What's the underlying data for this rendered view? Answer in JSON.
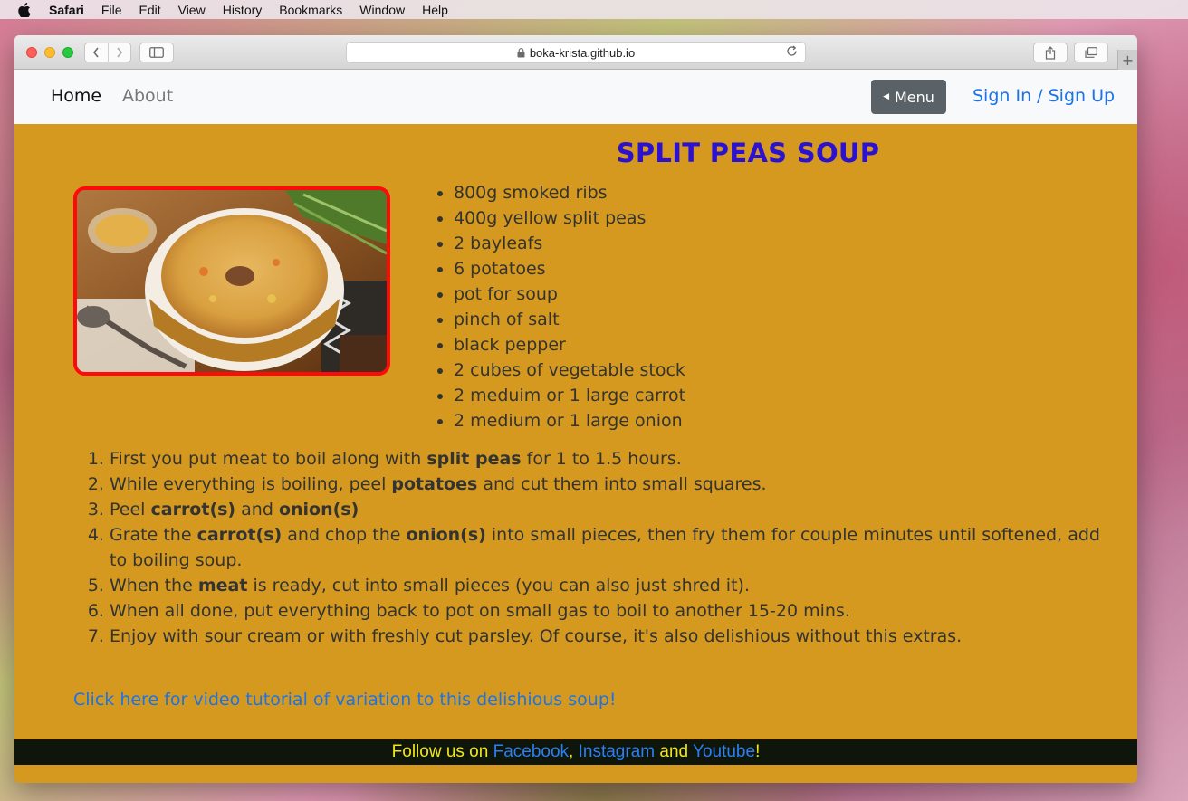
{
  "menubar": {
    "items": [
      "Safari",
      "File",
      "Edit",
      "View",
      "History",
      "Bookmarks",
      "Window",
      "Help"
    ]
  },
  "browser": {
    "url": "boka-krista.github.io"
  },
  "nav": {
    "home": "Home",
    "about": "About",
    "menu": "Menu",
    "signin": "Sign In / Sign Up"
  },
  "recipe": {
    "title": "SPLIT PEAS SOUP",
    "ingredients": [
      "800g smoked ribs",
      "400g yellow split peas",
      "2 bayleafs",
      "6 potatoes",
      "pot for soup",
      "pinch of salt",
      "black pepper",
      "2 cubes of vegetable stock",
      "2 meduim or 1 large carrot",
      "2 medium or 1 large onion"
    ],
    "steps": [
      {
        "parts": [
          {
            "t": "First you put meat to boil along with "
          },
          {
            "t": "split peas",
            "b": true
          },
          {
            "t": " for 1 to 1.5 hours."
          }
        ]
      },
      {
        "parts": [
          {
            "t": "While everything is boiling, peel "
          },
          {
            "t": "potatoes",
            "b": true
          },
          {
            "t": " and cut them into small squares."
          }
        ]
      },
      {
        "parts": [
          {
            "t": "Peel "
          },
          {
            "t": "carrot(s)",
            "b": true
          },
          {
            "t": " and "
          },
          {
            "t": "onion(s)",
            "b": true
          }
        ]
      },
      {
        "parts": [
          {
            "t": "Grate the "
          },
          {
            "t": "carrot(s)",
            "b": true
          },
          {
            "t": " and chop the "
          },
          {
            "t": "onion(s)",
            "b": true
          },
          {
            "t": " into small pieces, then fry them for couple minutes until softened, add to boiling soup."
          }
        ]
      },
      {
        "parts": [
          {
            "t": "When the "
          },
          {
            "t": "meat",
            "b": true
          },
          {
            "t": " is ready, cut into small pieces (you can also just shred it)."
          }
        ]
      },
      {
        "parts": [
          {
            "t": "When all done, put everything back to pot on small gas to boil to another 15-20 mins."
          }
        ]
      },
      {
        "parts": [
          {
            "t": "Enjoy with sour cream or with freshly cut parsley. Of course, it's also delishious without this extras."
          }
        ]
      }
    ],
    "video_link": "Click here for video tutorial of variation to this delishious soup!"
  },
  "footer": {
    "prefix": "Follow us on ",
    "facebook": "Facebook",
    "sep1": ", ",
    "instagram": "Instagram",
    "sep2": " and ",
    "youtube": "Youtube",
    "suffix": "!"
  },
  "colors": {
    "page_bg": "#d4991e",
    "title": "#2a12d0",
    "link": "#1a73e8",
    "footer_bg": "#0e160c",
    "footer_text": "#f0e61a",
    "photo_border": "#ff0a0a"
  }
}
